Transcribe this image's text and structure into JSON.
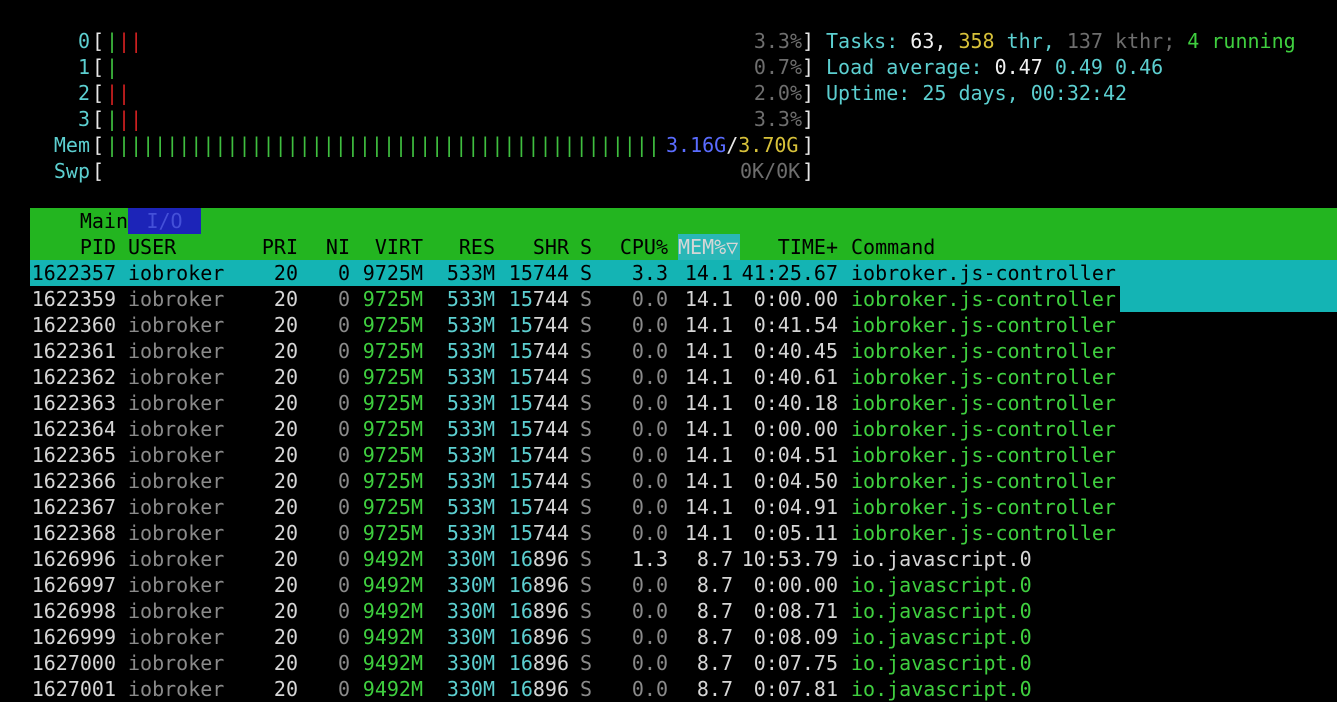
{
  "meters": {
    "cpus": [
      {
        "label": "0",
        "pct": "3.3%",
        "fill": 0.033
      },
      {
        "label": "1",
        "pct": "0.7%",
        "fill": 0.007
      },
      {
        "label": "2",
        "pct": "2.0%",
        "fill": 0.02
      },
      {
        "label": "3",
        "pct": "3.3%",
        "fill": 0.033
      }
    ],
    "mem": {
      "label": "Mem",
      "used": "3.16G",
      "total": "3.70G",
      "fill": 0.854
    },
    "swp": {
      "label": "Swp",
      "used": "0K",
      "total": "0K",
      "fill": 0.0
    }
  },
  "summary": {
    "tasks_label": "Tasks:",
    "tasks": "63,",
    "thr": "358",
    "thr_label": "thr,",
    "kthr": "137",
    "kthr_label": "kthr;",
    "running": "4",
    "running_label": "running",
    "load_label": "Load average:",
    "load1": "0.47",
    "load5": "0.49",
    "load15": "0.46",
    "uptime_label": "Uptime:",
    "uptime": "25 days, 00:32:42"
  },
  "tabs": {
    "main": "Main",
    "io": "I/O"
  },
  "columns": {
    "pid": "PID",
    "user": "USER",
    "pri": "PRI",
    "ni": "NI",
    "virt": "VIRT",
    "res": "RES",
    "shr": "SHR",
    "s": "S",
    "cpu": "CPU%",
    "mem": "MEM%▽",
    "time": "TIME+",
    "command": "Command"
  },
  "processes": [
    {
      "pid": "1622357",
      "user": "iobroker",
      "pri": "20",
      "ni": "0",
      "virt": "9725M",
      "res": "533M",
      "shr": "15744",
      "s": "S",
      "cpu": "3.3",
      "mem": "14.1",
      "time": "41:25.67",
      "command": "iobroker.js-controller",
      "selected": true
    },
    {
      "pid": "1622359",
      "user": "iobroker",
      "pri": "20",
      "ni": "0",
      "virt": "9725M",
      "res": "533M",
      "shr": "15744",
      "s": "S",
      "cpu": "0.0",
      "mem": "14.1",
      "time": "0:00.00",
      "command": "iobroker.js-controller"
    },
    {
      "pid": "1622360",
      "user": "iobroker",
      "pri": "20",
      "ni": "0",
      "virt": "9725M",
      "res": "533M",
      "shr": "15744",
      "s": "S",
      "cpu": "0.0",
      "mem": "14.1",
      "time": "0:41.54",
      "command": "iobroker.js-controller"
    },
    {
      "pid": "1622361",
      "user": "iobroker",
      "pri": "20",
      "ni": "0",
      "virt": "9725M",
      "res": "533M",
      "shr": "15744",
      "s": "S",
      "cpu": "0.0",
      "mem": "14.1",
      "time": "0:40.45",
      "command": "iobroker.js-controller"
    },
    {
      "pid": "1622362",
      "user": "iobroker",
      "pri": "20",
      "ni": "0",
      "virt": "9725M",
      "res": "533M",
      "shr": "15744",
      "s": "S",
      "cpu": "0.0",
      "mem": "14.1",
      "time": "0:40.61",
      "command": "iobroker.js-controller"
    },
    {
      "pid": "1622363",
      "user": "iobroker",
      "pri": "20",
      "ni": "0",
      "virt": "9725M",
      "res": "533M",
      "shr": "15744",
      "s": "S",
      "cpu": "0.0",
      "mem": "14.1",
      "time": "0:40.18",
      "command": "iobroker.js-controller"
    },
    {
      "pid": "1622364",
      "user": "iobroker",
      "pri": "20",
      "ni": "0",
      "virt": "9725M",
      "res": "533M",
      "shr": "15744",
      "s": "S",
      "cpu": "0.0",
      "mem": "14.1",
      "time": "0:00.00",
      "command": "iobroker.js-controller"
    },
    {
      "pid": "1622365",
      "user": "iobroker",
      "pri": "20",
      "ni": "0",
      "virt": "9725M",
      "res": "533M",
      "shr": "15744",
      "s": "S",
      "cpu": "0.0",
      "mem": "14.1",
      "time": "0:04.51",
      "command": "iobroker.js-controller"
    },
    {
      "pid": "1622366",
      "user": "iobroker",
      "pri": "20",
      "ni": "0",
      "virt": "9725M",
      "res": "533M",
      "shr": "15744",
      "s": "S",
      "cpu": "0.0",
      "mem": "14.1",
      "time": "0:04.50",
      "command": "iobroker.js-controller"
    },
    {
      "pid": "1622367",
      "user": "iobroker",
      "pri": "20",
      "ni": "0",
      "virt": "9725M",
      "res": "533M",
      "shr": "15744",
      "s": "S",
      "cpu": "0.0",
      "mem": "14.1",
      "time": "0:04.91",
      "command": "iobroker.js-controller"
    },
    {
      "pid": "1622368",
      "user": "iobroker",
      "pri": "20",
      "ni": "0",
      "virt": "9725M",
      "res": "533M",
      "shr": "15744",
      "s": "S",
      "cpu": "0.0",
      "mem": "14.1",
      "time": "0:05.11",
      "command": "iobroker.js-controller"
    },
    {
      "pid": "1626996",
      "user": "iobroker",
      "pri": "20",
      "ni": "0",
      "virt": "9492M",
      "res": "330M",
      "shr": "16896",
      "s": "S",
      "cpu": "1.3",
      "mem": "8.7",
      "time": "10:53.79",
      "command": "io.javascript.0",
      "main": true
    },
    {
      "pid": "1626997",
      "user": "iobroker",
      "pri": "20",
      "ni": "0",
      "virt": "9492M",
      "res": "330M",
      "shr": "16896",
      "s": "S",
      "cpu": "0.0",
      "mem": "8.7",
      "time": "0:00.00",
      "command": "io.javascript.0"
    },
    {
      "pid": "1626998",
      "user": "iobroker",
      "pri": "20",
      "ni": "0",
      "virt": "9492M",
      "res": "330M",
      "shr": "16896",
      "s": "S",
      "cpu": "0.0",
      "mem": "8.7",
      "time": "0:08.71",
      "command": "io.javascript.0"
    },
    {
      "pid": "1626999",
      "user": "iobroker",
      "pri": "20",
      "ni": "0",
      "virt": "9492M",
      "res": "330M",
      "shr": "16896",
      "s": "S",
      "cpu": "0.0",
      "mem": "8.7",
      "time": "0:08.09",
      "command": "io.javascript.0"
    },
    {
      "pid": "1627000",
      "user": "iobroker",
      "pri": "20",
      "ni": "0",
      "virt": "9492M",
      "res": "330M",
      "shr": "16896",
      "s": "S",
      "cpu": "0.0",
      "mem": "8.7",
      "time": "0:07.75",
      "command": "io.javascript.0"
    },
    {
      "pid": "1627001",
      "user": "iobroker",
      "pri": "20",
      "ni": "0",
      "virt": "9492M",
      "res": "330M",
      "shr": "16896",
      "s": "S",
      "cpu": "0.0",
      "mem": "8.7",
      "time": "0:07.81",
      "command": "io.javascript.0"
    }
  ],
  "colors": {
    "background": "#000000",
    "header": "#23b520",
    "selection": "#14b4b4",
    "tab_io": "#1c24b8"
  }
}
